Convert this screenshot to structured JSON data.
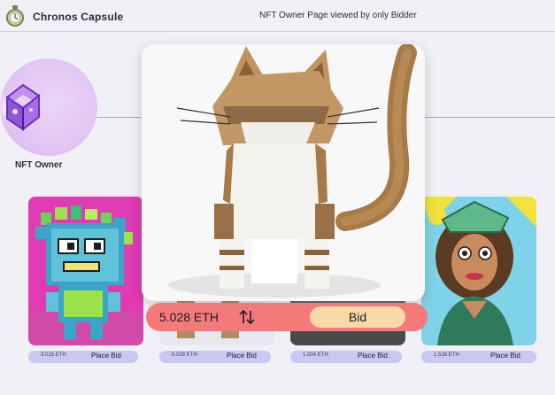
{
  "header": {
    "app_name": "Chronos Capsule",
    "page_caption": "NFT Owner Page viewed by only Bidder",
    "logo_icon": "pocket-watch-icon"
  },
  "owner": {
    "label": "NFT Owner",
    "avatar_icon": "glowing-cube-icon"
  },
  "featured": {
    "price": "5.028 ETH",
    "swap_icon": "swap-arrows-icon",
    "bid_label": "Bid"
  },
  "cards": [
    {
      "price": "3.015 ETH",
      "action": "Place Bid"
    },
    {
      "price": "5.028 ETH",
      "action": "Place Bid"
    },
    {
      "price": "1.004 ETH",
      "action": "Place Bid"
    },
    {
      "price": "1.528 ETH",
      "action": "Place Bid"
    }
  ],
  "colors": {
    "background": "#f1f0f6",
    "bid_bar": "#f47a7a",
    "bid_button": "#f9d9a5",
    "card_pill": "#c9c7f4"
  }
}
